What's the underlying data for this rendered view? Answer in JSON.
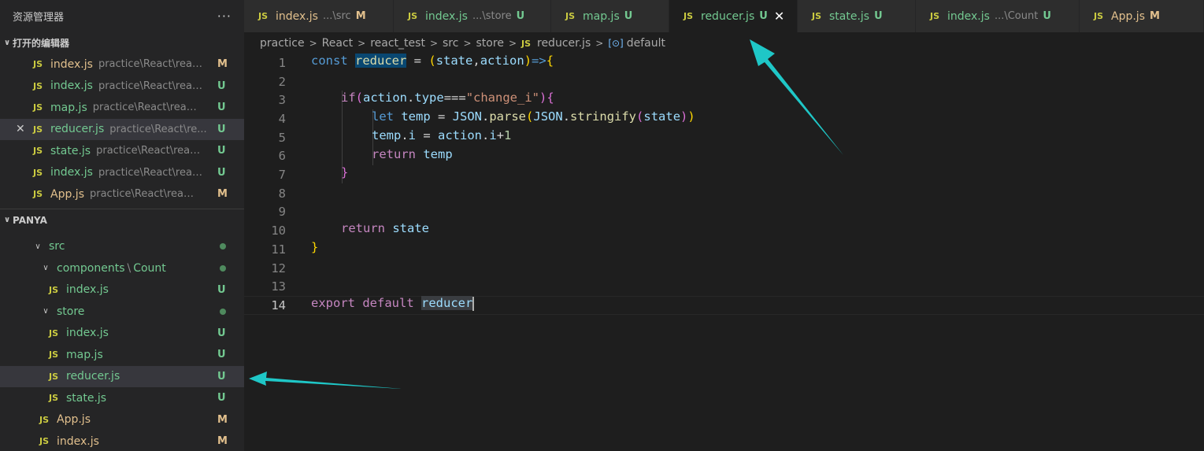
{
  "sidebar": {
    "title": "资源管理器",
    "more": "···",
    "open_editors": {
      "title": "打开的编辑器",
      "items": [
        {
          "name": "index.js",
          "path": "practice\\React\\reac...",
          "badge": "M",
          "status": "m"
        },
        {
          "name": "index.js",
          "path": "practice\\React\\react...",
          "badge": "U",
          "status": "u"
        },
        {
          "name": "map.js",
          "path": "practice\\React\\react_...",
          "badge": "U",
          "status": "u"
        },
        {
          "name": "reducer.js",
          "path": "practice\\React\\re...",
          "badge": "U",
          "status": "u"
        },
        {
          "name": "state.js",
          "path": "practice\\React\\react...",
          "badge": "U",
          "status": "u"
        },
        {
          "name": "index.js",
          "path": "practice\\React\\react...",
          "badge": "U",
          "status": "u"
        },
        {
          "name": "App.js",
          "path": "practice\\React\\react_...",
          "badge": "M",
          "status": "m"
        }
      ],
      "close_glyph": "✕"
    },
    "workspace": {
      "title": "PANYA",
      "src": "src",
      "components": "components",
      "count": "Count",
      "count_index": "index.js",
      "count_index_badge": "U",
      "store": "store",
      "store_files": [
        {
          "name": "index.js",
          "badge": "U"
        },
        {
          "name": "map.js",
          "badge": "U"
        },
        {
          "name": "reducer.js",
          "badge": "U"
        },
        {
          "name": "state.js",
          "badge": "U"
        }
      ],
      "app": "App.js",
      "app_badge": "M",
      "index": "index.js",
      "index_badge": "M"
    },
    "js_label": "JS"
  },
  "tabs": [
    {
      "name": "index.js",
      "path": "...\\src",
      "badge": "M",
      "status": "m"
    },
    {
      "name": "index.js",
      "path": "...\\store",
      "badge": "U",
      "status": "u"
    },
    {
      "name": "map.js",
      "path": "",
      "badge": "U",
      "status": "u"
    },
    {
      "name": "reducer.js",
      "path": "",
      "badge": "U",
      "status": "u",
      "active": true
    },
    {
      "name": "state.js",
      "path": "",
      "badge": "U",
      "status": "u"
    },
    {
      "name": "index.js",
      "path": "...\\Count",
      "badge": "U",
      "status": "u"
    },
    {
      "name": "App.js",
      "path": "",
      "badge": "M",
      "status": "m"
    }
  ],
  "breadcrumb": {
    "parts": [
      "practice",
      "React",
      "react_test",
      "src",
      "store"
    ],
    "file": "reducer.js",
    "symbol_icon": "[⊙]",
    "symbol": "default"
  },
  "editor": {
    "line_numbers": [
      "1",
      "2",
      "3",
      "4",
      "5",
      "6",
      "7",
      "8",
      "9",
      "10",
      "11",
      "12",
      "13",
      "14"
    ],
    "current_line": "14",
    "code": {
      "l1_const": "const",
      "l1_name": "reducer",
      "l1_eq": " = ",
      "l1_open": "(",
      "l1_state": "state",
      "l1_comma": ",",
      "l1_action": "action",
      "l1_close": ")",
      "l1_arrow": "=>",
      "l1_brace": "{",
      "l3_if": "if",
      "l3_open": "(",
      "l3_action": "action",
      "l3_dot": ".",
      "l3_type": "type",
      "l3_op": "===",
      "l3_str": "\"change_i\"",
      "l3_close": ")",
      "l3_brace": "{",
      "l4_let": "let",
      "l4_temp": "temp",
      "l4_eq": " = ",
      "l4_json1": "JSON",
      "l4_parse": "parse",
      "l4_json2": "JSON",
      "l4_stringify": "stringify",
      "l4_state": "state",
      "l5_temp": "temp",
      "l5_i": "i",
      "l5_eq": " = ",
      "l5_action": "action",
      "l5_i2": "i",
      "l5_plus": "+",
      "l5_one": "1",
      "l6_return": "return",
      "l6_temp": "temp",
      "l7_brace": "}",
      "l10_return": "return",
      "l10_state": "state",
      "l11_brace": "}",
      "l14_export": "export",
      "l14_default": "default",
      "l14_reducer": "reducer"
    }
  },
  "colors": {
    "annotation_arrow": "#1fc7c7"
  }
}
